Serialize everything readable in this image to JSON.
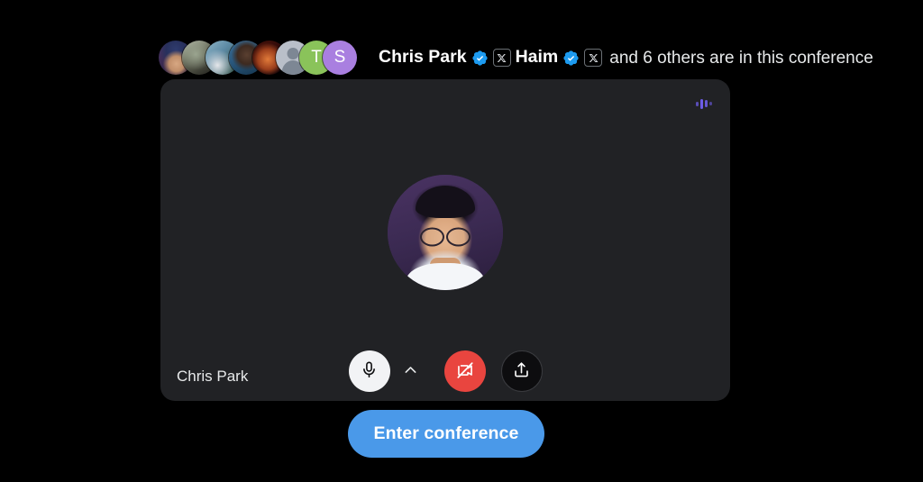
{
  "colors": {
    "page_background": "#000000",
    "panel_background": "#212225",
    "accent_blue": "#4a99e9",
    "verified_blue": "#1d9bf0",
    "camera_off_red": "#e9453f",
    "mic_active_white": "#f2f3f5",
    "level_purple": "#6c5ce7"
  },
  "header": {
    "participants": [
      {
        "name": "participant-1",
        "type": "photo",
        "style": "ph-a"
      },
      {
        "name": "participant-2",
        "type": "photo",
        "style": "ph-b"
      },
      {
        "name": "participant-3",
        "type": "photo",
        "style": "ph-c"
      },
      {
        "name": "participant-4",
        "type": "photo",
        "style": "ph-d"
      },
      {
        "name": "participant-5",
        "type": "photo",
        "style": "ph-e"
      },
      {
        "name": "participant-6",
        "type": "default",
        "style": "ph-default"
      },
      {
        "name": "participant-7",
        "type": "initial",
        "style": "ph-green",
        "initial": "T"
      },
      {
        "name": "participant-8",
        "type": "initial",
        "style": "ph-purple",
        "initial": "S"
      }
    ],
    "speaker_one": "Chris Park",
    "speaker_one_verified": true,
    "speaker_one_affiliate": "X",
    "speaker_two": "Haim",
    "speaker_two_verified": true,
    "speaker_two_affiliate": "X",
    "tail_text": "and 6 others are in this conference",
    "others_count": 6
  },
  "panel": {
    "participant_name": "Chris Park",
    "level_indicator_name": "audio-level-indicator",
    "avatar_alt": "Chris Park profile photo",
    "controls": {
      "mic": {
        "label": "Microphone",
        "state": "on",
        "icon": "microphone-icon"
      },
      "mic_options": {
        "label": "Microphone options",
        "icon": "chevron-up-icon"
      },
      "camera": {
        "label": "Camera",
        "state": "off",
        "icon": "camera-off-icon"
      },
      "share": {
        "label": "Share",
        "state": "default",
        "icon": "share-upload-icon"
      }
    }
  },
  "footer": {
    "enter_label": "Enter conference"
  }
}
